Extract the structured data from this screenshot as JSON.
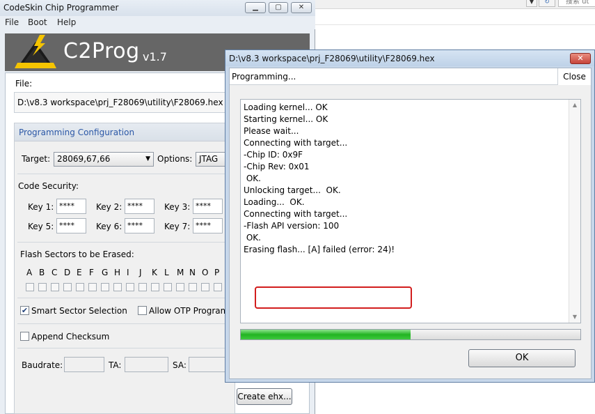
{
  "background": {
    "search_placeholder": "搜索 ut"
  },
  "main_window": {
    "title": "CodeSkin Chip Programmer",
    "menu": [
      "File",
      "Boot",
      "Help"
    ],
    "banner": {
      "app_name": "C2Prog",
      "version": "v1.7"
    },
    "file": {
      "label": "File:",
      "path": "D:\\v8.3 workspace\\prj_F28069\\utility\\F28069.hex"
    },
    "config": {
      "title": "Programming Configuration",
      "target_label": "Target:",
      "target_value": "28069,67,66",
      "options_label": "Options:",
      "options_value": "JTAG",
      "code_security_label": "Code Security:",
      "keys": [
        {
          "label": "Key 1:",
          "value": "****"
        },
        {
          "label": "Key 2:",
          "value": "****"
        },
        {
          "label": "Key 3:",
          "value": "****"
        },
        {
          "label": "Key 5:",
          "value": "****"
        },
        {
          "label": "Key 6:",
          "value": "****"
        },
        {
          "label": "Key 7:",
          "value": "****"
        }
      ],
      "flash_sectors_label": "Flash Sectors to be Erased:",
      "sectors": [
        "A",
        "B",
        "C",
        "D",
        "E",
        "F",
        "G",
        "H",
        "I",
        "J",
        "K",
        "L",
        "M",
        "N",
        "O",
        "P"
      ],
      "smart_sector_label": "Smart Sector Selection",
      "smart_sector_checked": true,
      "allow_otp_label": "Allow OTP Program",
      "allow_otp_checked": false,
      "append_checksum_label": "Append Checksum",
      "append_checksum_checked": false,
      "baudrate_label": "Baudrate:",
      "ta_label": "TA:",
      "sa_label": "SA:"
    },
    "create_ehx_label": "Create ehx..."
  },
  "dialog": {
    "title": "D:\\v8.3 workspace\\prj_F28069\\utility\\F28069.hex",
    "close_glyph": "✕",
    "status": "Programming...",
    "close_button": "Close",
    "log": [
      "Loading kernel... OK",
      "Starting kernel... OK",
      "Please wait...",
      "Connecting with target...",
      "-Chip ID: 0x9F",
      "-Chip Rev: 0x01",
      " OK.",
      "Unlocking target...  OK.",
      "Loading...  OK.",
      "Connecting with target...",
      "-Flash API version: 100",
      " OK.",
      "Erasing flash... [A] failed (error: 24)!"
    ],
    "progress_fraction": 0.5,
    "ok_button": "OK"
  }
}
